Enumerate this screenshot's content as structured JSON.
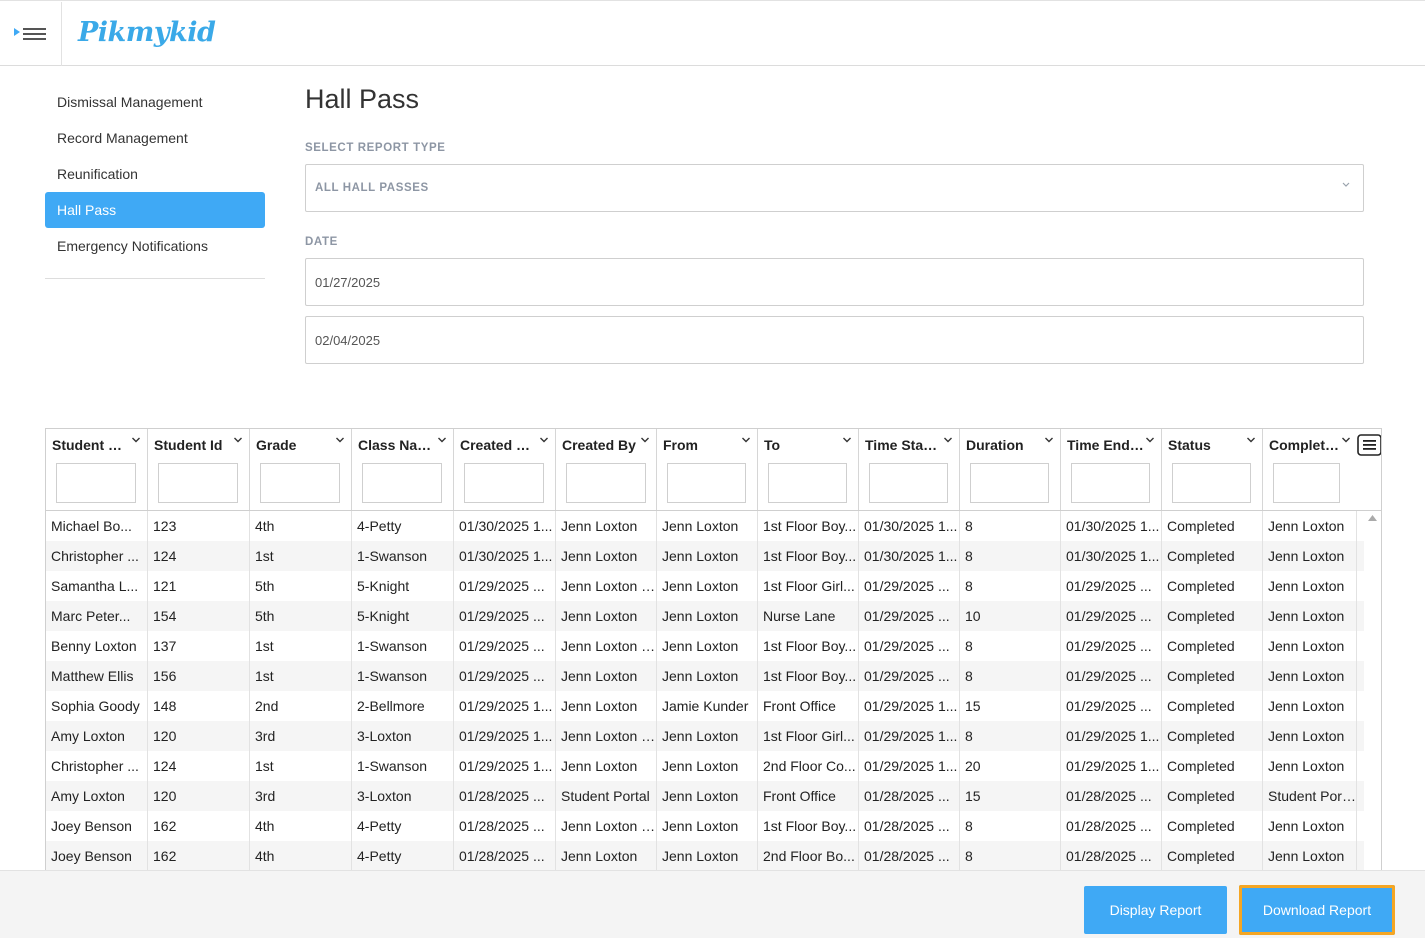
{
  "brand": {
    "logo_text": "Pikmykid",
    "accent": "#3fa9f5",
    "logo_color": "#3aa9e8",
    "highlight": "#f5a623"
  },
  "sidebar": {
    "items": [
      {
        "label": "Dismissal Management",
        "active": false
      },
      {
        "label": "Record Management",
        "active": false
      },
      {
        "label": "Reunification",
        "active": false
      },
      {
        "label": "Hall Pass",
        "active": true
      },
      {
        "label": "Emergency Notifications",
        "active": false
      }
    ]
  },
  "main": {
    "title": "Hall Pass",
    "report_type_label": "SELECT REPORT TYPE",
    "report_type_value": "ALL HALL PASSES",
    "date_label": "DATE",
    "start_date": "01/27/2025",
    "end_date": "02/04/2025"
  },
  "grid": {
    "columns": [
      "Student Name",
      "Student Id",
      "Grade",
      "Class Name",
      "Created Date",
      "Created By",
      "From",
      "To",
      "Time Started",
      "Duration",
      "Time Ended",
      "Status",
      "Completed By"
    ],
    "rows": [
      [
        "Michael Bo...",
        "123",
        "4th",
        "4-Petty",
        "01/30/2025 1...",
        "Jenn Loxton",
        "Jenn Loxton",
        "1st Floor Boy...",
        "01/30/2025 1...",
        "8",
        "01/30/2025 1...",
        "Completed",
        "Jenn Loxton"
      ],
      [
        "Christopher ...",
        "124",
        "1st",
        "1-Swanson",
        "01/30/2025 1...",
        "Jenn Loxton",
        "Jenn Loxton",
        "1st Floor Boy...",
        "01/30/2025 1...",
        "8",
        "01/30/2025 1...",
        "Completed",
        "Jenn Loxton"
      ],
      [
        "Samantha L...",
        "121",
        "5th",
        "5-Knight",
        "01/29/2025 ...",
        "Jenn Loxton (...",
        "Jenn Loxton",
        "1st Floor Girl...",
        "01/29/2025 ...",
        "8",
        "01/29/2025 ...",
        "Completed",
        "Jenn Loxton"
      ],
      [
        "Marc Peter...",
        "154",
        "5th",
        "5-Knight",
        "01/29/2025 ...",
        "Jenn Loxton",
        "Jenn Loxton",
        "Nurse Lane",
        "01/29/2025 ...",
        "10",
        "01/29/2025 ...",
        "Completed",
        "Jenn Loxton"
      ],
      [
        "Benny Loxton",
        "137",
        "1st",
        "1-Swanson",
        "01/29/2025 ...",
        "Jenn Loxton (...",
        "Jenn Loxton",
        "1st Floor Boy...",
        "01/29/2025 ...",
        "8",
        "01/29/2025 ...",
        "Completed",
        "Jenn Loxton"
      ],
      [
        "Matthew Ellis",
        "156",
        "1st",
        "1-Swanson",
        "01/29/2025 ...",
        "Jenn Loxton",
        "Jenn Loxton",
        "1st Floor Boy...",
        "01/29/2025 ...",
        "8",
        "01/29/2025 ...",
        "Completed",
        "Jenn Loxton"
      ],
      [
        "Sophia Goody",
        "148",
        "2nd",
        "2-Bellmore",
        "01/29/2025 1...",
        "Jenn Loxton",
        "Jamie Kunder",
        "Front Office",
        "01/29/2025 1...",
        "15",
        "01/29/2025 ...",
        "Completed",
        "Jenn Loxton"
      ],
      [
        "Amy Loxton",
        "120",
        "3rd",
        "3-Loxton",
        "01/29/2025 1...",
        "Jenn Loxton (...",
        "Jenn Loxton",
        "1st Floor Girl...",
        "01/29/2025 1...",
        "8",
        "01/29/2025 1...",
        "Completed",
        "Jenn Loxton"
      ],
      [
        "Christopher ...",
        "124",
        "1st",
        "1-Swanson",
        "01/29/2025 1...",
        "Jenn Loxton",
        "Jenn Loxton",
        "2nd Floor Co...",
        "01/29/2025 1...",
        "20",
        "01/29/2025 1...",
        "Completed",
        "Jenn Loxton"
      ],
      [
        "Amy Loxton",
        "120",
        "3rd",
        "3-Loxton",
        "01/28/2025 ...",
        "Student Portal",
        "Jenn Loxton",
        "Front Office",
        "01/28/2025 ...",
        "15",
        "01/28/2025 ...",
        "Completed",
        "Student Portal"
      ],
      [
        "Joey Benson",
        "162",
        "4th",
        "4-Petty",
        "01/28/2025 ...",
        "Jenn Loxton (...",
        "Jenn Loxton",
        "1st Floor Boy...",
        "01/28/2025 ...",
        "8",
        "01/28/2025 ...",
        "Completed",
        "Jenn Loxton"
      ],
      [
        "Joey Benson",
        "162",
        "4th",
        "4-Petty",
        "01/28/2025 ...",
        "Jenn Loxton",
        "Jenn Loxton",
        "2nd Floor Bo...",
        "01/28/2025 ...",
        "8",
        "01/28/2025 ...",
        "Completed",
        "Jenn Loxton"
      ]
    ]
  },
  "footer": {
    "display_label": "Display Report",
    "download_label": "Download Report"
  },
  "icons": [
    "menu-toggle-icon",
    "chevron-down-icon",
    "column-menu-icon",
    "scroll-up-icon"
  ]
}
